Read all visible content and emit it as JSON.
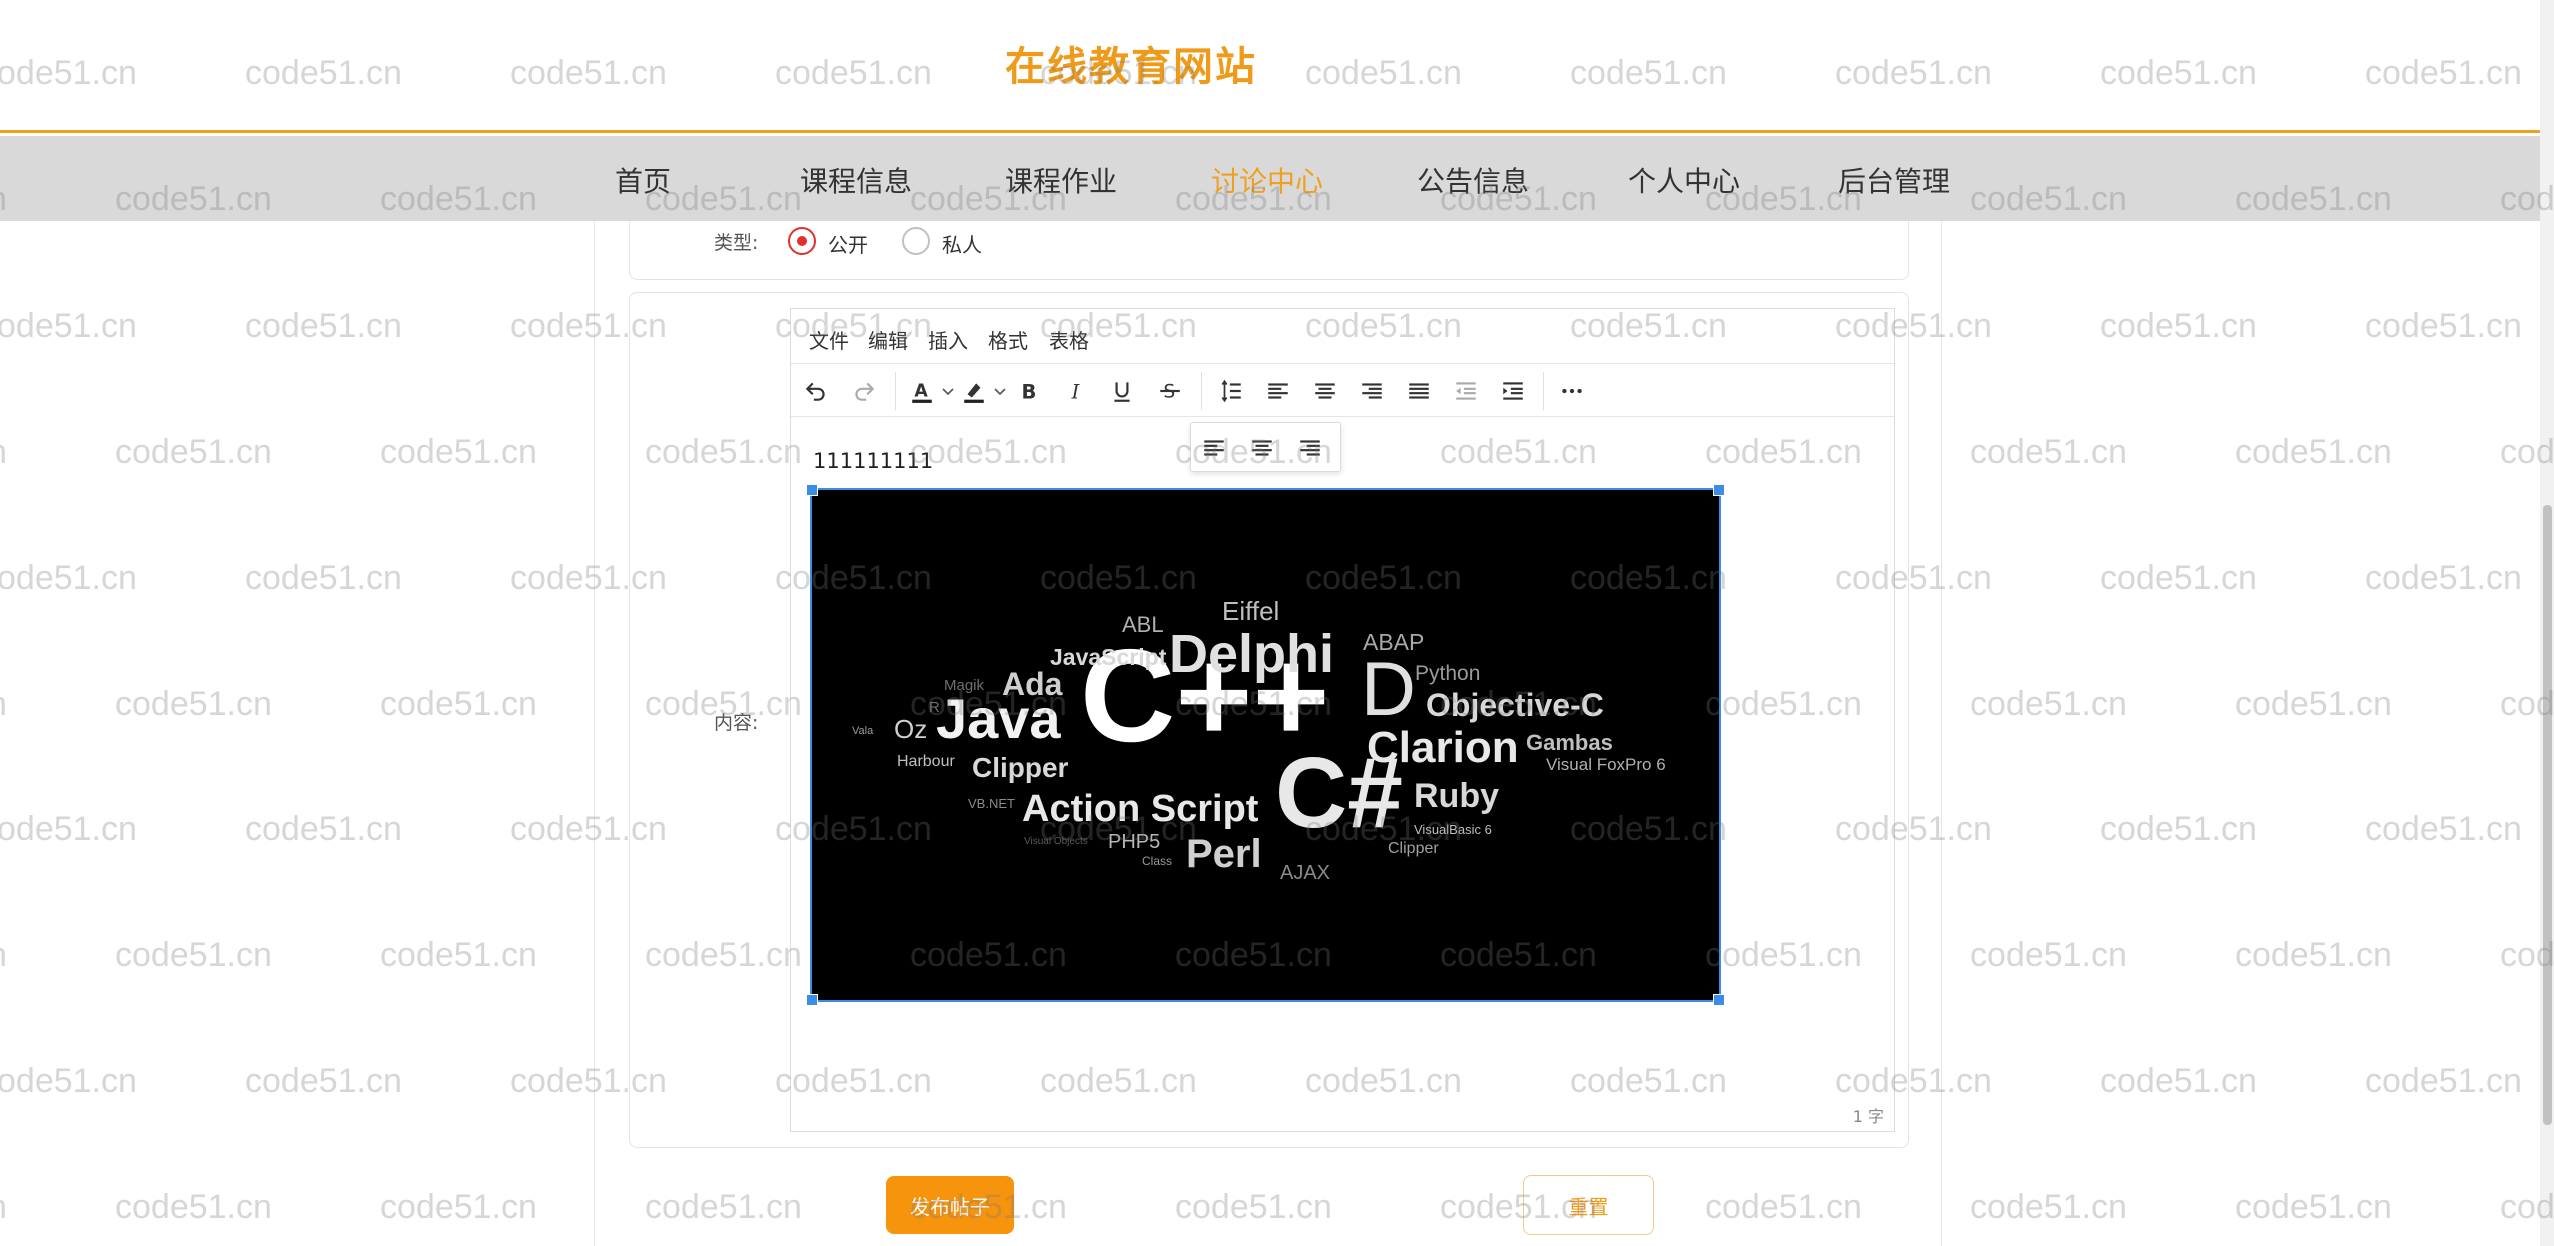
{
  "site": {
    "title": "在线教育网站",
    "accent": "#f0a020"
  },
  "nav": {
    "items": [
      {
        "label": "首页"
      },
      {
        "label": "课程信息"
      },
      {
        "label": "课程作业"
      },
      {
        "label": "讨论中心"
      },
      {
        "label": "公告信息"
      },
      {
        "label": "个人中心"
      },
      {
        "label": "后台管理"
      }
    ],
    "active": "讨论中心"
  },
  "form": {
    "type_label": "类型:",
    "type_options": [
      {
        "label": "公开",
        "checked": true
      },
      {
        "label": "私人",
        "checked": false
      }
    ],
    "content_label": "内容:"
  },
  "editor": {
    "menus": [
      {
        "label": "文件"
      },
      {
        "label": "编辑"
      },
      {
        "label": "插入"
      },
      {
        "label": "格式"
      },
      {
        "label": "表格"
      }
    ],
    "toolbar_icons": [
      "undo-icon",
      "redo-icon",
      "text-color-icon",
      "highlight-icon",
      "bold-icon",
      "italic-icon",
      "underline-icon",
      "strikethrough-icon",
      "line-height-icon",
      "align-left-icon",
      "align-center-icon",
      "align-right-icon",
      "align-justify-icon",
      "outdent-icon",
      "indent-icon",
      "more-icon"
    ],
    "body_text": "111111111",
    "word_count": "1 字"
  },
  "image": {
    "description_words": [
      {
        "text": "C++"
      },
      {
        "text": "C#"
      },
      {
        "text": "D"
      },
      {
        "text": "Delphi"
      },
      {
        "text": "Java"
      },
      {
        "text": "Clarion"
      },
      {
        "text": "Action Script"
      },
      {
        "text": "Objective-C"
      },
      {
        "text": "Ruby"
      },
      {
        "text": "Perl"
      },
      {
        "text": "Ada"
      },
      {
        "text": "Clipper"
      },
      {
        "text": "JavaScript"
      },
      {
        "text": "Eiffel"
      },
      {
        "text": "ABAP"
      },
      {
        "text": "Python"
      },
      {
        "text": "Gambas"
      },
      {
        "text": "Visual FoxPro 6"
      },
      {
        "text": "ABL"
      },
      {
        "text": "Oz"
      },
      {
        "text": "Harbour"
      },
      {
        "text": "Magik"
      },
      {
        "text": "R"
      },
      {
        "text": "Vala"
      },
      {
        "text": "VB.NET"
      },
      {
        "text": "PHP5"
      },
      {
        "text": "Class"
      },
      {
        "text": "AJAX"
      },
      {
        "text": "VisualBasic 6"
      },
      {
        "text": "Clipper"
      },
      {
        "text": "Visual Objects"
      }
    ]
  },
  "buttons": {
    "submit": "发布帖子",
    "reset": "重置"
  },
  "watermark": {
    "text": "code51.cn"
  }
}
